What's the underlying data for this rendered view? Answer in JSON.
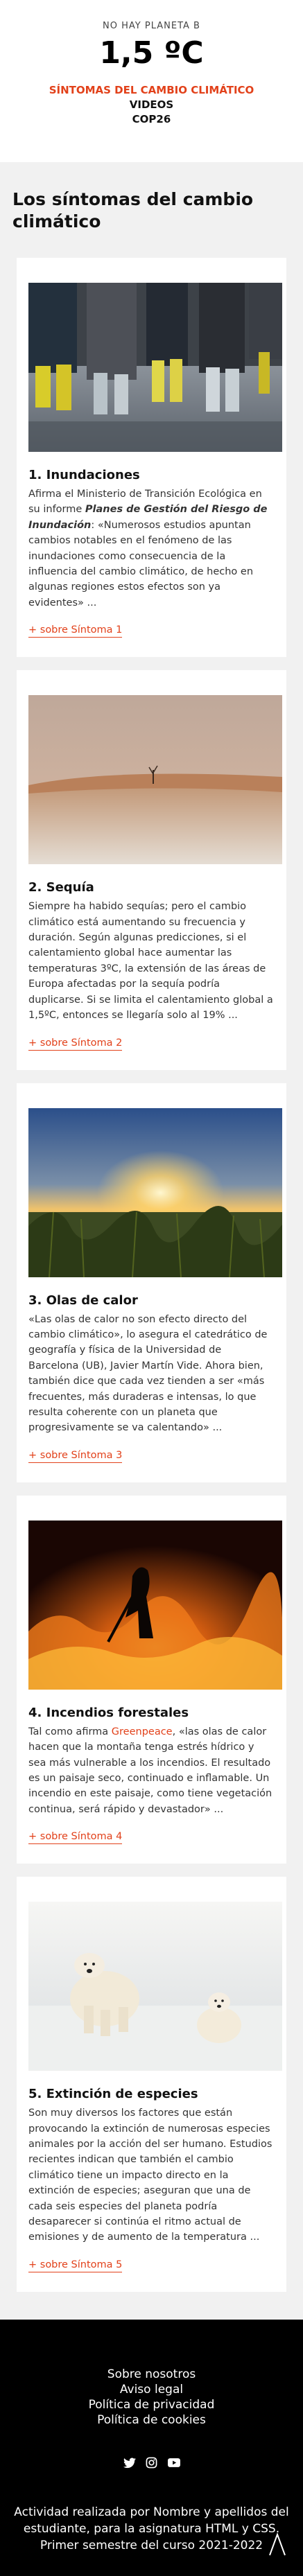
{
  "header": {
    "kicker": "NO HAY PLANETA B",
    "logo": "1,5 ºC",
    "nav": [
      {
        "label": "SÍNTOMAS DEL CAMBIO CLIMÁTICO"
      },
      {
        "label": "VIDEOS"
      },
      {
        "label": "COP26"
      }
    ]
  },
  "page_title": "Los síntomas del cambio climático",
  "cards": [
    {
      "title": "1. Inundaciones",
      "text_a": "Afirma el Ministerio de Transición Ecológica en su informe ",
      "text_em": "Planes de Gestión del Riesgo de Inundación",
      "text_b": ": «Numerosos estudios apuntan cambios notables en el fenómeno de las inundaciones como consecuencia de la influencia del cambio climático, de hecho en algunas regiones estos efectos son ya evidentes» ...",
      "more": "+ sobre Síntoma 1"
    },
    {
      "title": "2. Sequía",
      "text": "Siempre ha habido sequías; pero el cambio climático está aumentando su frecuencia y duración. Según algunas predicciones, si el calentamiento global hace aumentar las temperaturas 3ºC, la extensión de las áreas de Europa afectadas por la sequía podría duplicarse. Si se limita el calentamiento global a 1,5ºC, entonces se llegaría solo al 19% ...",
      "more": "+ sobre Síntoma 2"
    },
    {
      "title": "3. Olas de calor",
      "text": "«Las olas de calor no son efecto directo del cambio climático», lo asegura el catedrático de geografía y física de la Universidad de Barcelona (UB), Javier Martín Vide. Ahora bien, también dice que cada vez tienden a ser «más frecuentes, más duraderas e intensas, lo que resulta coherente con un planeta que progresivamente se va calentando» ...",
      "more": "+ sobre Síntoma 3"
    },
    {
      "title": "4. Incendios forestales",
      "text_a": "Tal como afirma ",
      "text_link": "Greenpeace",
      "text_b": ", «las olas de calor hacen que la montaña tenga estrés hídrico y sea más vulnerable a los incendios. El resultado es un paisaje seco, continuado e inflamable. Un incendio en este paisaje, como tiene vegetación continua, será rápido y devastador» ...",
      "more": "+ sobre Síntoma 4"
    },
    {
      "title": "5. Extinción de especies",
      "text": "Son muy diversos los factores que están provocando la extinción de numerosas especies animales por la acción del ser humano. Estudios recientes indican que también el cambio climático tiene un impacto directo en la extinción de especies; aseguran que una de cada seis especies del planeta podría desaparecer si continúa el ritmo actual de emisiones y de aumento de la temperatura ...",
      "more": "+ sobre Síntoma 5"
    }
  ],
  "footer": {
    "links": [
      {
        "label": "Sobre nosotros"
      },
      {
        "label": "Aviso legal"
      },
      {
        "label": "Política de privacidad"
      },
      {
        "label": "Política de cookies"
      }
    ],
    "social_icons": [
      "twitter-icon",
      "instagram-icon",
      "youtube-icon"
    ],
    "credits": "Actividad realizada por Nombre y apellidos del estudiante, para la asignatura HTML y CSS. Primer semestre del curso 2021-2022"
  },
  "colors": {
    "accent": "#e2411a",
    "background": "#f1f1f1",
    "footer": "#000000"
  }
}
